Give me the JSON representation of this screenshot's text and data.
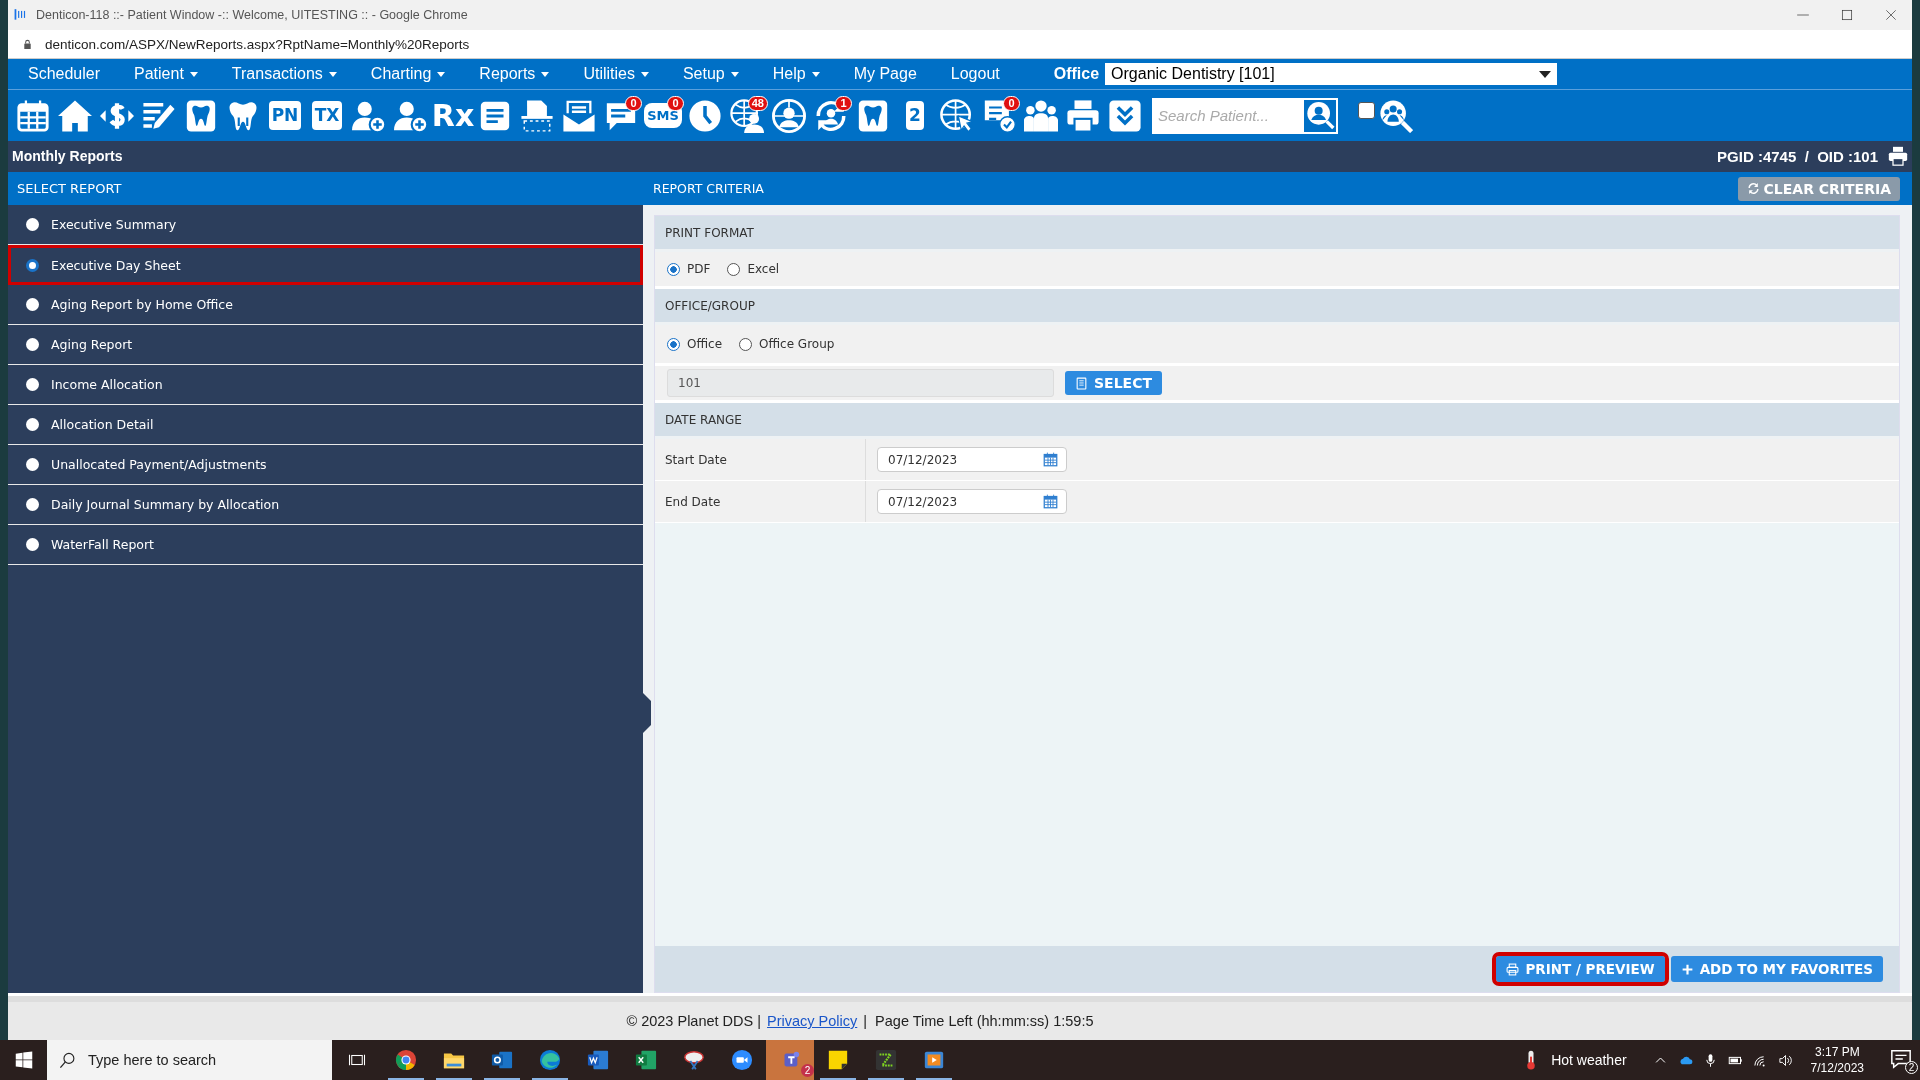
{
  "window": {
    "title": "Denticon-118 ::- Patient Window -:: Welcome, UITESTING :: - Google Chrome",
    "url": "denticon.com/ASPX/NewReports.aspx?RptName=Monthly%20Reports"
  },
  "menu": [
    {
      "label": "Scheduler",
      "dropdown": false
    },
    {
      "label": "Patient",
      "dropdown": true
    },
    {
      "label": "Transactions",
      "dropdown": true
    },
    {
      "label": "Charting",
      "dropdown": true
    },
    {
      "label": "Reports",
      "dropdown": true
    },
    {
      "label": "Utilities",
      "dropdown": true
    },
    {
      "label": "Setup",
      "dropdown": true
    },
    {
      "label": "Help",
      "dropdown": true
    },
    {
      "label": "My Page",
      "dropdown": false
    },
    {
      "label": "Logout",
      "dropdown": false
    }
  ],
  "office": {
    "label": "Office",
    "value": "Organic Dentistry [101]"
  },
  "toolbar": [
    {
      "kind": "calendar"
    },
    {
      "kind": "home"
    },
    {
      "kind": "dollar"
    },
    {
      "kind": "list-pencil"
    },
    {
      "kind": "tooth-tile"
    },
    {
      "kind": "tooth"
    },
    {
      "kind": "tile",
      "label": "PN"
    },
    {
      "kind": "tile",
      "label": "TX"
    },
    {
      "kind": "person-plus"
    },
    {
      "kind": "person-plus"
    },
    {
      "kind": "plain",
      "label": "Rx"
    },
    {
      "kind": "note"
    },
    {
      "kind": "scanner"
    },
    {
      "kind": "envelope"
    },
    {
      "kind": "chat",
      "badge": "0"
    },
    {
      "kind": "bubble",
      "label": "SMS",
      "badge": "0"
    },
    {
      "kind": "clock"
    },
    {
      "kind": "globe-person",
      "badge": "48"
    },
    {
      "kind": "globe-user"
    },
    {
      "kind": "refresh-user",
      "badge": "1"
    },
    {
      "kind": "tooth-tile"
    },
    {
      "kind": "tile",
      "label": "2"
    },
    {
      "kind": "globe-cursor"
    },
    {
      "kind": "document-check",
      "badge": "0"
    },
    {
      "kind": "people"
    },
    {
      "kind": "printer"
    },
    {
      "kind": "chevron"
    }
  ],
  "patient_search": {
    "placeholder": "Search Patient...",
    "checked": false
  },
  "page": {
    "title": "Monthly Reports",
    "ids": "PGID :4745  /  OID :101"
  },
  "select_report": {
    "title": "SELECT REPORT",
    "items": [
      {
        "label": "Executive Summary",
        "selected": false
      },
      {
        "label": "Executive Day Sheet",
        "selected": true
      },
      {
        "label": "Aging Report by Home Office",
        "selected": false
      },
      {
        "label": "Aging Report",
        "selected": false
      },
      {
        "label": "Income Allocation",
        "selected": false
      },
      {
        "label": "Allocation Detail",
        "selected": false
      },
      {
        "label": "Unallocated Payment/Adjustments",
        "selected": false
      },
      {
        "label": "Daily Journal Summary by Allocation",
        "selected": false
      },
      {
        "label": "WaterFall Report",
        "selected": false
      }
    ]
  },
  "criteria": {
    "title": "REPORT CRITERIA",
    "clear_button": "CLEAR CRITERIA",
    "print_format": {
      "title": "PRINT FORMAT",
      "options": [
        {
          "label": "PDF",
          "selected": true
        },
        {
          "label": "Excel",
          "selected": false
        }
      ]
    },
    "office_group": {
      "title": "OFFICE/GROUP",
      "options": [
        {
          "label": "Office",
          "selected": true
        },
        {
          "label": "Office Group",
          "selected": false
        }
      ],
      "value": "101",
      "select_button": "SELECT"
    },
    "date_range": {
      "title": "DATE RANGE",
      "fields": [
        {
          "label": "Start Date",
          "value": "07/12/2023"
        },
        {
          "label": "End Date",
          "value": "07/12/2023"
        }
      ]
    },
    "print_button": "PRINT / PREVIEW",
    "favorites_button": "ADD TO MY FAVORITES"
  },
  "footer": {
    "copyright": "© 2023 Planet DDS |",
    "link": "Privacy Policy",
    "timer": "|  Page Time Left (hh:mm:ss) 1:59:5"
  },
  "taskbar": {
    "search_placeholder": "Type here to search",
    "apps": [
      {
        "kind": "chrome",
        "running": true,
        "selected": false
      },
      {
        "kind": "folder",
        "running": true,
        "selected": false
      },
      {
        "kind": "outlook",
        "running": true,
        "selected": false
      },
      {
        "kind": "edge",
        "running": true,
        "selected": false
      },
      {
        "kind": "word",
        "running": false,
        "selected": false
      },
      {
        "kind": "excel",
        "running": false,
        "selected": false
      },
      {
        "kind": "snip",
        "running": false,
        "selected": false
      },
      {
        "kind": "zoom",
        "running": false,
        "selected": false
      },
      {
        "kind": "teams",
        "running": true,
        "selected": true,
        "badge": "2"
      },
      {
        "kind": "sticky",
        "running": true,
        "selected": false
      },
      {
        "kind": "green",
        "running": true,
        "selected": false
      },
      {
        "kind": "player",
        "running": true,
        "selected": false
      }
    ],
    "weather": "Hot weather",
    "time": "3:17 PM",
    "date": "7/12/2023",
    "notifications": "2"
  }
}
